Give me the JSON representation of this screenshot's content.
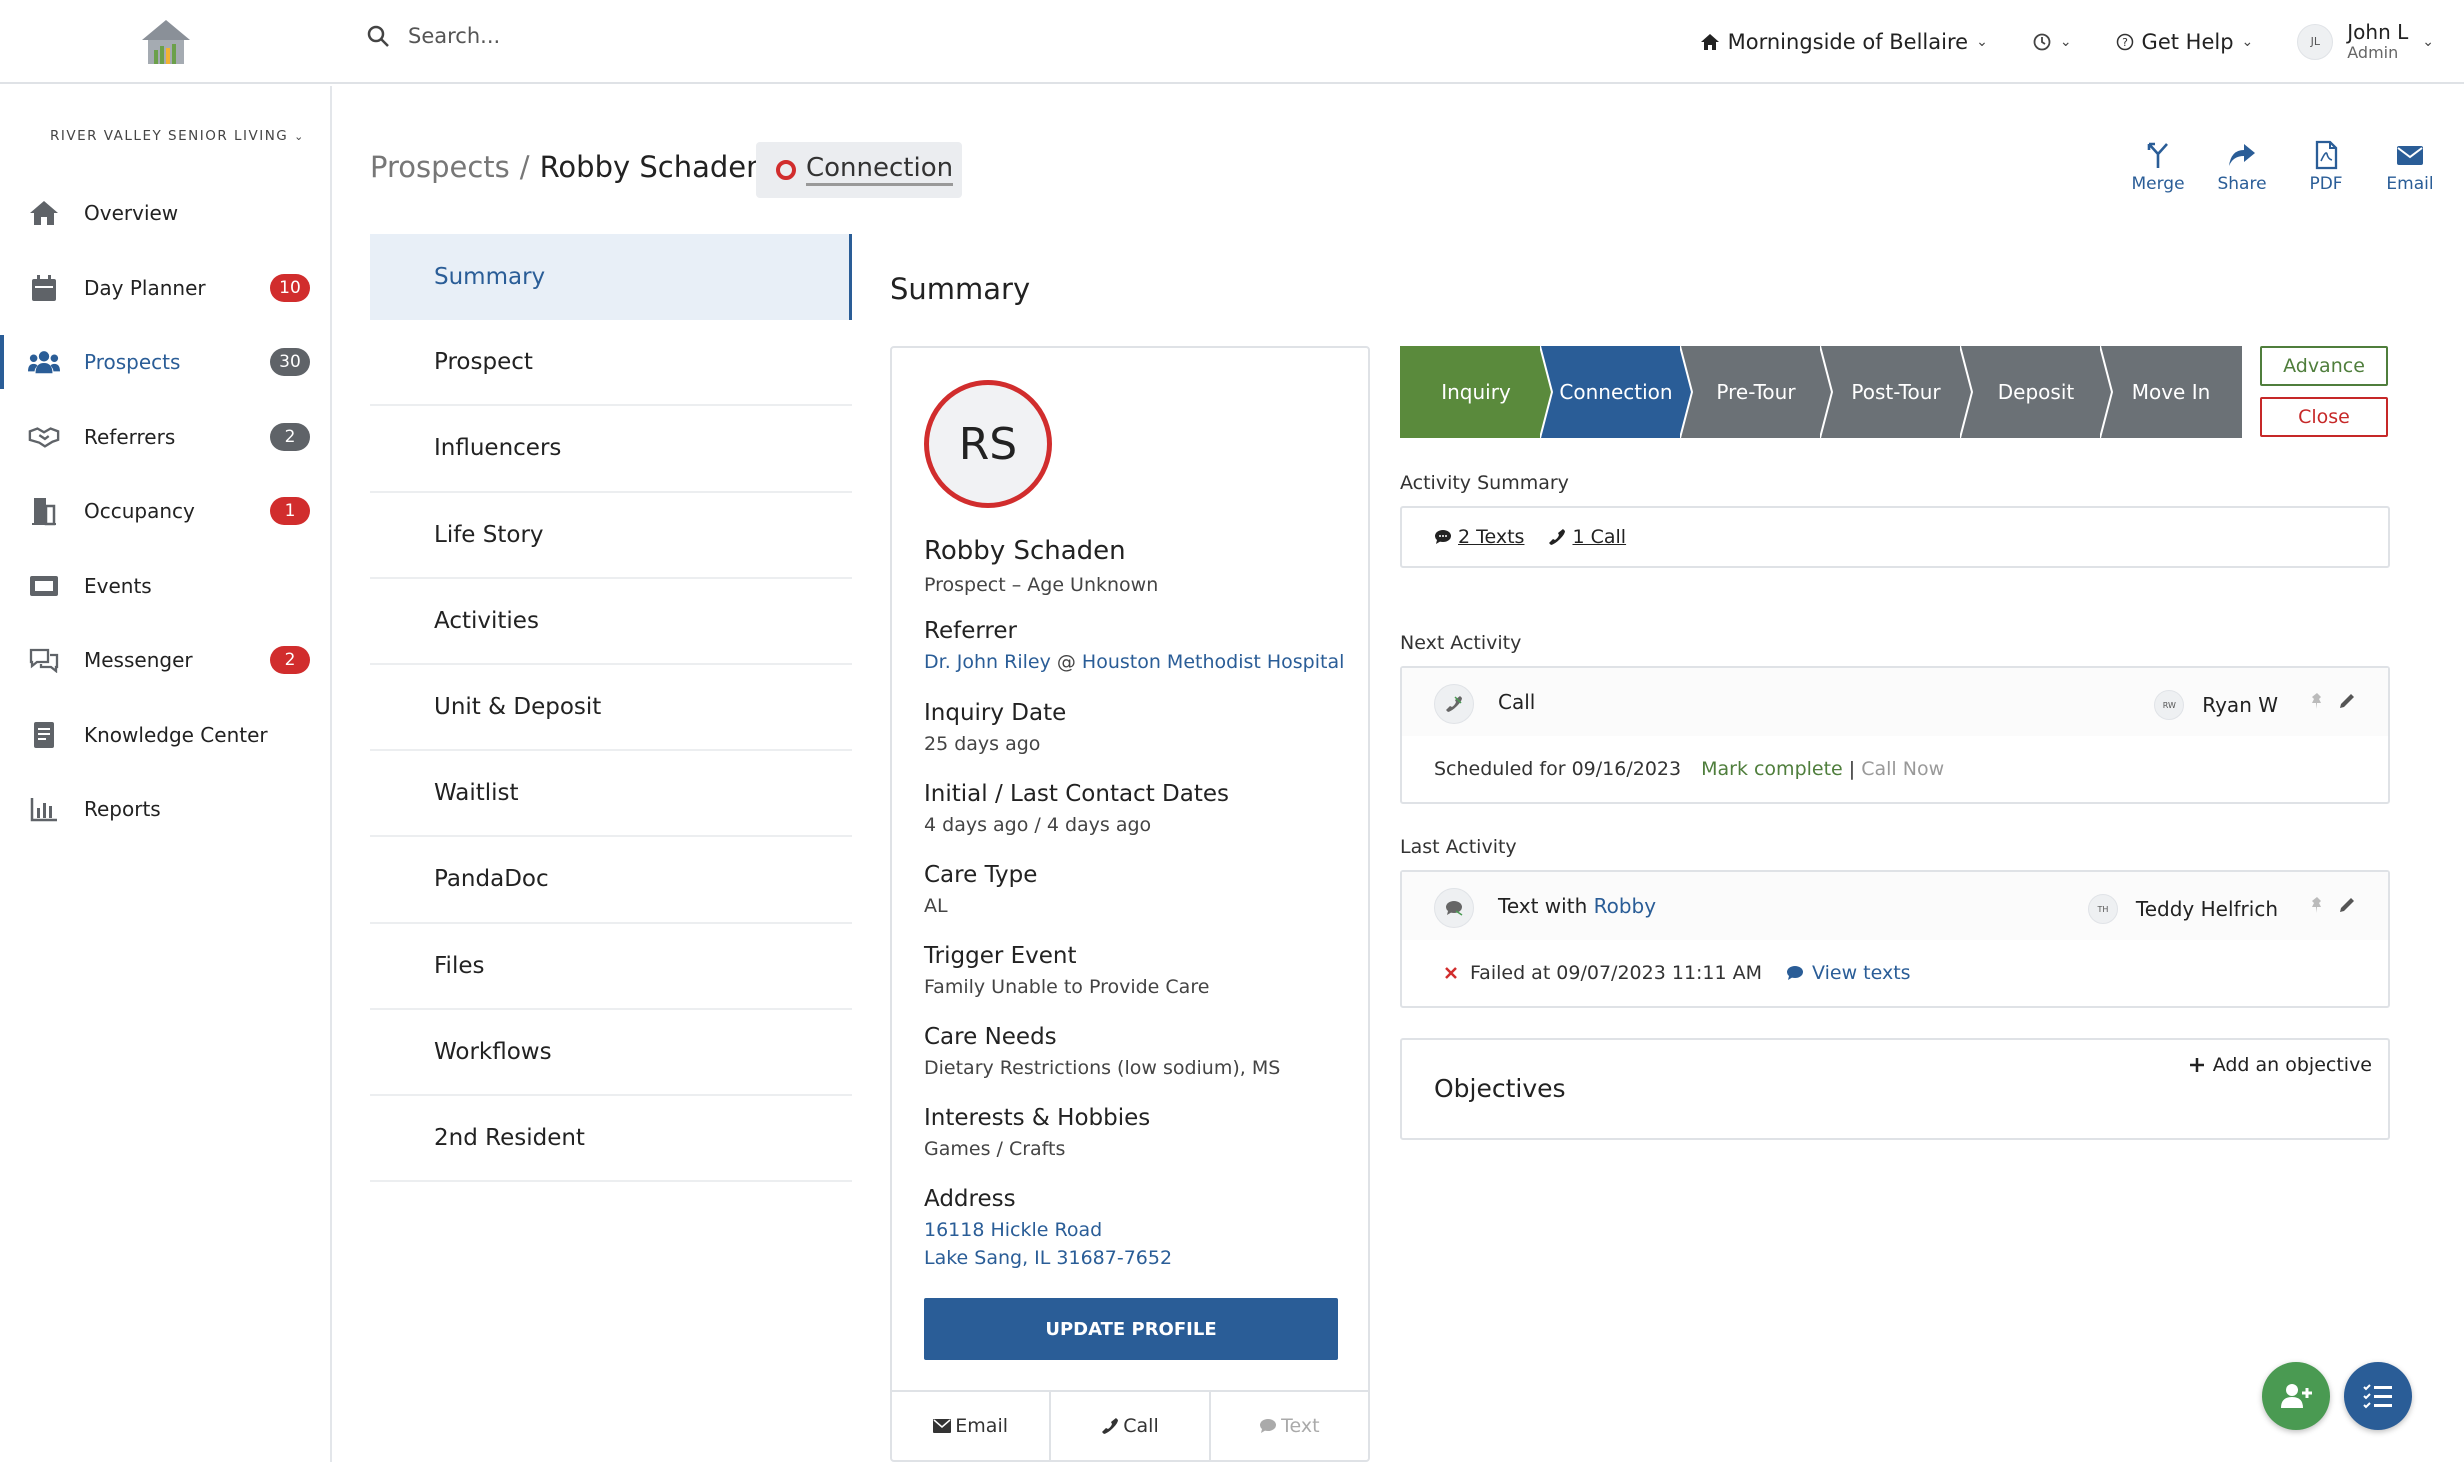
{
  "header": {
    "search_placeholder": "Search...",
    "community": "Morningside of Bellaire",
    "help": "Get Help",
    "user_initials": "JL",
    "user_name": "John L",
    "user_role": "Admin"
  },
  "sidebar": {
    "org": "RIVER VALLEY SENIOR LIVING",
    "items": [
      {
        "label": "Overview",
        "icon": "home-icon"
      },
      {
        "label": "Day Planner",
        "icon": "calendar-icon",
        "badge": "10",
        "badge_color": "#d12d2d"
      },
      {
        "label": "Prospects",
        "icon": "users-icon",
        "badge": "30",
        "badge_color": "#5f6368"
      },
      {
        "label": "Referrers",
        "icon": "handshake-icon",
        "badge": "2",
        "badge_color": "#5f6368"
      },
      {
        "label": "Occupancy",
        "icon": "building-icon",
        "badge": "1",
        "badge_color": "#d12d2d"
      },
      {
        "label": "Events",
        "icon": "ticket-icon"
      },
      {
        "label": "Messenger",
        "icon": "chat-icon",
        "badge": "2",
        "badge_color": "#d12d2d"
      },
      {
        "label": "Knowledge Center",
        "icon": "book-icon"
      },
      {
        "label": "Reports",
        "icon": "chart-icon"
      }
    ]
  },
  "breadcrumb": {
    "parent": "Prospects",
    "separator": "/",
    "current": "Robby Schaden"
  },
  "status_chip": "Connection",
  "actions": {
    "merge": "Merge",
    "share": "Share",
    "pdf": "PDF",
    "email": "Email"
  },
  "tabs": [
    "Summary",
    "Prospect",
    "Influencers",
    "Life Story",
    "Activities",
    "Unit & Deposit",
    "Waitlist",
    "PandaDoc",
    "Files",
    "Workflows",
    "2nd Resident"
  ],
  "summary": {
    "title": "Summary",
    "profile": {
      "initials": "RS",
      "name": "Robby Schaden",
      "subtitle": "Prospect – Age Unknown",
      "referrer_label": "Referrer",
      "referrer_person": "Dr. John Riley",
      "referrer_at": "@",
      "referrer_org": "Houston Methodist Hospital",
      "inquiry_label": "Inquiry Date",
      "inquiry_value": "25 days ago",
      "contact_label": "Initial / Last Contact Dates",
      "contact_value": "4 days ago / 4 days ago",
      "care_type_label": "Care Type",
      "care_type_value": "AL",
      "trigger_label": "Trigger Event",
      "trigger_value": "Family Unable to Provide Care",
      "needs_label": "Care Needs",
      "needs_value": "Dietary Restrictions (low sodium), MS",
      "interests_label": "Interests & Hobbies",
      "interests_value": "Games / Crafts",
      "address_label": "Address",
      "address_line1": "16118 Hickle Road",
      "address_line2": "Lake Sang, IL 31687-7652",
      "update_button": "UPDATE PROFILE",
      "email_btn": "Email",
      "call_btn": "Call",
      "text_btn": "Text"
    },
    "pipeline": {
      "stages": [
        {
          "label": "Inquiry",
          "color": "#5a8a3c"
        },
        {
          "label": "Connection",
          "color": "#2a5d97"
        },
        {
          "label": "Pre-Tour",
          "color": "#6b7176"
        },
        {
          "label": "Post-Tour",
          "color": "#6b7176"
        },
        {
          "label": "Deposit",
          "color": "#6b7176"
        },
        {
          "label": "Move In",
          "color": "#6b7176"
        }
      ],
      "advance": "Advance",
      "close": "Close"
    },
    "activity_summary": {
      "label": "Activity Summary",
      "texts": "2 Texts",
      "calls": "1 Call"
    },
    "next_activity": {
      "label": "Next Activity",
      "type": "Call",
      "assignee_initials": "RW",
      "assignee": "Ryan W",
      "scheduled": "Scheduled for 09/16/2023",
      "mark_complete": "Mark complete",
      "divider": "|",
      "call_now": "Call Now"
    },
    "last_activity": {
      "label": "Last Activity",
      "type_prefix": "Text with",
      "type_link": "Robby",
      "assignee_initials": "TH",
      "assignee": "Teddy Helfrich",
      "failed": "Failed at 09/07/2023 11:11 AM",
      "view_texts": "View texts"
    },
    "objectives": {
      "title": "Objectives",
      "add": "Add an objective"
    }
  }
}
